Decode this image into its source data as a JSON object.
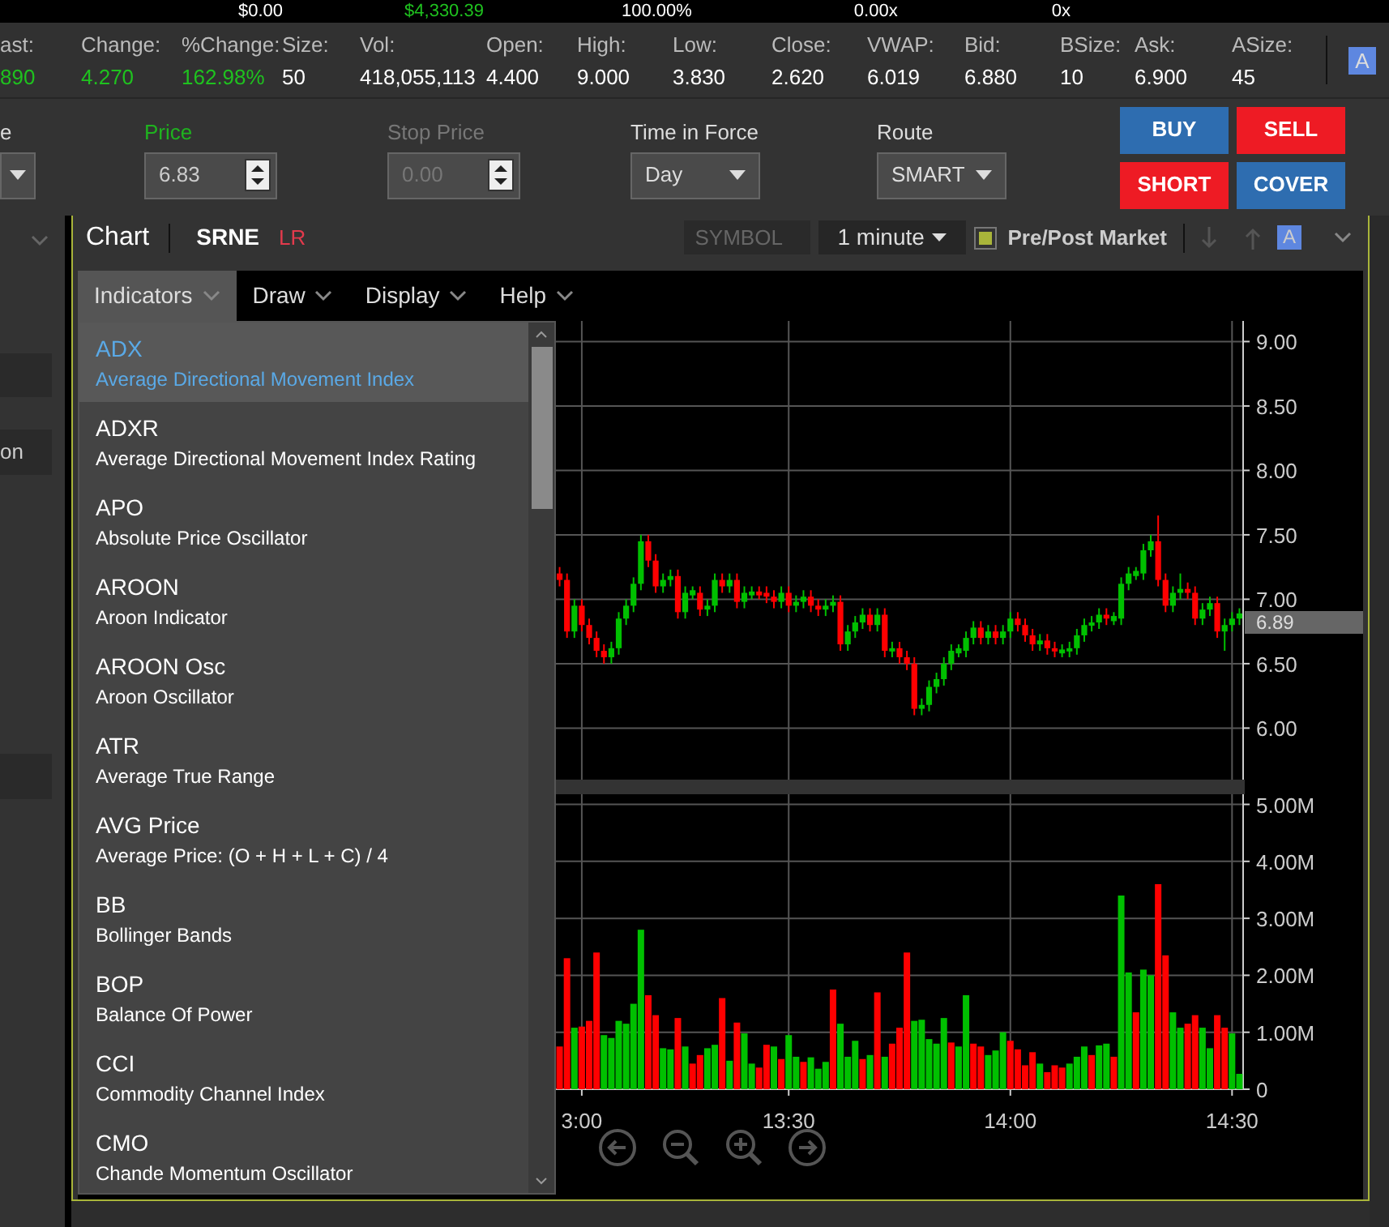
{
  "top_strip": [
    {
      "text": "$0.00",
      "color": "#ffffff"
    },
    {
      "text": "$4,330.39",
      "color": "#1fc21f"
    },
    {
      "text": "100.00%",
      "color": "#ffffff"
    },
    {
      "text": "0.00x",
      "color": "#ffffff"
    },
    {
      "text": "0x",
      "color": "#ffffff"
    }
  ],
  "quote": [
    {
      "label": "ast:",
      "value": "890",
      "color": "#1fc21f"
    },
    {
      "label": "Change:",
      "value": "4.270",
      "color": "#1fc21f"
    },
    {
      "label": "%Change:",
      "value": "162.98%",
      "color": "#1fc21f"
    },
    {
      "label": "Size:",
      "value": "50",
      "color": "#ffffff"
    },
    {
      "label": "Vol:",
      "value": "418,055,113",
      "color": "#ffffff"
    },
    {
      "label": "Open:",
      "value": "4.400",
      "color": "#ffffff"
    },
    {
      "label": "High:",
      "value": "9.000",
      "color": "#ffffff"
    },
    {
      "label": "Low:",
      "value": "3.830",
      "color": "#ffffff"
    },
    {
      "label": "Close:",
      "value": "2.620",
      "color": "#ffffff"
    },
    {
      "label": "VWAP:",
      "value": "6.019",
      "color": "#ffffff"
    },
    {
      "label": "Bid:",
      "value": "6.880",
      "color": "#ffffff"
    },
    {
      "label": "BSize:",
      "value": "10",
      "color": "#ffffff"
    },
    {
      "label": "Ask:",
      "value": "6.900",
      "color": "#ffffff"
    },
    {
      "label": "ASize:",
      "value": "45",
      "color": "#ffffff"
    }
  ],
  "quote_font_button": "A",
  "order_fields": [
    {
      "kind": "select",
      "label": "e",
      "active": false,
      "disabled": false
    },
    {
      "kind": "spinner",
      "label": "Price",
      "value": "6.83",
      "active": true,
      "disabled": false
    },
    {
      "kind": "spinner",
      "label": "Stop Price",
      "placeholder": "0.00",
      "active": false,
      "disabled": true
    },
    {
      "kind": "select",
      "label": "Time in Force",
      "value": "Day",
      "active": false,
      "disabled": false
    },
    {
      "kind": "select",
      "label": "Route",
      "value": "SMART",
      "active": false,
      "disabled": false
    }
  ],
  "order_buttons": [
    {
      "label": "BUY",
      "color": "#2e6db0"
    },
    {
      "label": "SELL",
      "color": "#ee1b24"
    },
    {
      "label": "SHORT",
      "color": "#ee1b24"
    },
    {
      "label": "COVER",
      "color": "#2e6db0"
    }
  ],
  "side_panel": {
    "items": [
      "on"
    ]
  },
  "chart_panel": {
    "title": "Chart",
    "symbol": "SRNE",
    "tag": "LR",
    "symbol_placeholder": "SYMBOL",
    "interval": "1 minute",
    "prepost": {
      "label": "Pre/Post Market",
      "checked": true
    },
    "font_button": "A"
  },
  "menu": [
    {
      "label": "Indicators",
      "selected": true
    },
    {
      "label": "Draw",
      "selected": false
    },
    {
      "label": "Display",
      "selected": false
    },
    {
      "label": "Help",
      "selected": false
    }
  ],
  "indicators": [
    {
      "code": "ADX",
      "name": "Average Directional Movement Index",
      "selected": true
    },
    {
      "code": "ADXR",
      "name": "Average Directional Movement Index Rating",
      "selected": false
    },
    {
      "code": "APO",
      "name": "Absolute Price Oscillator",
      "selected": false
    },
    {
      "code": "AROON",
      "name": "Aroon Indicator",
      "selected": false
    },
    {
      "code": "AROON Osc",
      "name": "Aroon Oscillator",
      "selected": false
    },
    {
      "code": "ATR",
      "name": "Average True Range",
      "selected": false
    },
    {
      "code": "AVG Price",
      "name": "Average Price: (O + H + L + C) / 4",
      "selected": false
    },
    {
      "code": "BB",
      "name": "Bollinger Bands",
      "selected": false
    },
    {
      "code": "BOP",
      "name": "Balance Of Power",
      "selected": false
    },
    {
      "code": "CCI",
      "name": "Commodity Channel Index",
      "selected": false
    },
    {
      "code": "CMO",
      "name": "Chande Momentum Oscillator",
      "selected": false
    }
  ],
  "price_chart": {
    "chart_data": {
      "type": "candlestick",
      "grid": true,
      "ylim": [
        5.6,
        9.16
      ],
      "yticks": [
        {
          "value": 6,
          "label": "6.00"
        },
        {
          "value": 6.5,
          "label": "6.50"
        },
        {
          "value": 7,
          "label": "7.00"
        },
        {
          "value": 7.5,
          "label": "7.50"
        },
        {
          "value": 8,
          "label": "8.00"
        },
        {
          "value": 8.5,
          "label": "8.50"
        },
        {
          "value": 9,
          "label": "9.00"
        }
      ],
      "categories": [
        null,
        null,
        null,
        null,
        null,
        null,
        null,
        null,
        null,
        null,
        null,
        null,
        null,
        null,
        null,
        null,
        null,
        null,
        null,
        null,
        null,
        null,
        null,
        null,
        null,
        null,
        null,
        null,
        null,
        null,
        null,
        null,
        null,
        null,
        null,
        null,
        null,
        null,
        null,
        null,
        null,
        null,
        null,
        null,
        null,
        null,
        null,
        null,
        null,
        null,
        null,
        null,
        null,
        null,
        null,
        null,
        null,
        null,
        null,
        null,
        null,
        null,
        null,
        null,
        null,
        null,
        null,
        null,
        null,
        null,
        null,
        null,
        null,
        null,
        null,
        null,
        null,
        null,
        null,
        null,
        null,
        null,
        null,
        null,
        null,
        null,
        null,
        null,
        null,
        null,
        null,
        null,
        null
      ],
      "ohlc": [
        [
          7.2,
          7.25,
          7.1,
          7.15
        ],
        [
          7.15,
          7.2,
          6.7,
          6.75
        ],
        [
          6.75,
          7,
          6.7,
          6.95
        ],
        [
          6.95,
          7,
          6.75,
          6.8
        ],
        [
          6.8,
          6.85,
          6.65,
          6.7
        ],
        [
          6.7,
          6.75,
          6.55,
          6.6
        ],
        [
          6.6,
          6.65,
          6.5,
          6.55
        ],
        [
          6.55,
          6.67,
          6.5,
          6.62
        ],
        [
          6.62,
          6.9,
          6.57,
          6.85
        ],
        [
          6.85,
          7,
          6.8,
          6.95
        ],
        [
          6.95,
          7.17,
          6.9,
          7.12
        ],
        [
          7.12,
          7.5,
          7.07,
          7.45
        ],
        [
          7.45,
          7.5,
          7.25,
          7.3
        ],
        [
          7.3,
          7.35,
          7.05,
          7.1
        ],
        [
          7.1,
          7.2,
          7.05,
          7.15
        ],
        [
          7.15,
          7.23,
          7.1,
          7.18
        ],
        [
          7.18,
          7.23,
          6.85,
          6.9
        ],
        [
          6.9,
          7.1,
          6.85,
          7.05
        ],
        [
          7.03,
          7.1,
          7,
          7.07
        ],
        [
          7.05,
          7.1,
          6.87,
          6.92
        ],
        [
          6.92,
          7,
          6.87,
          6.95
        ],
        [
          6.95,
          7.2,
          6.9,
          7.15
        ],
        [
          7.15,
          7.2,
          7.05,
          7.1
        ],
        [
          7.1,
          7.2,
          7.05,
          7.15
        ],
        [
          7.15,
          7.2,
          6.93,
          6.98
        ],
        [
          6.98,
          7.1,
          6.93,
          7.05
        ],
        [
          7.03,
          7.1,
          7,
          7.06
        ],
        [
          7.06,
          7.1,
          7,
          7.03
        ],
        [
          7.05,
          7.1,
          6.97,
          7.02
        ],
        [
          7.02,
          7.07,
          6.93,
          6.98
        ],
        [
          6.98,
          7.1,
          6.93,
          7.05
        ],
        [
          7.05,
          7.1,
          6.9,
          6.95
        ],
        [
          6.95,
          7.03,
          6.9,
          6.98
        ],
        [
          6.98,
          7.07,
          6.93,
          7.02
        ],
        [
          7.02,
          7.07,
          6.9,
          6.95
        ],
        [
          6.95,
          7,
          6.87,
          6.92
        ],
        [
          6.92,
          7,
          6.87,
          6.95
        ],
        [
          6.95,
          7.03,
          6.9,
          6.98
        ],
        [
          6.98,
          7.03,
          6.6,
          6.65
        ],
        [
          6.65,
          6.8,
          6.6,
          6.75
        ],
        [
          6.75,
          6.87,
          6.7,
          6.82
        ],
        [
          6.82,
          6.93,
          6.77,
          6.88
        ],
        [
          6.88,
          6.93,
          6.75,
          6.8
        ],
        [
          6.8,
          6.93,
          6.75,
          6.88
        ],
        [
          6.88,
          6.93,
          6.55,
          6.6
        ],
        [
          6.6,
          6.67,
          6.55,
          6.62
        ],
        [
          6.62,
          6.67,
          6.5,
          6.55
        ],
        [
          6.55,
          6.6,
          6.45,
          6.5
        ],
        [
          6.5,
          6.55,
          6.1,
          6.15
        ],
        [
          6.15,
          6.23,
          6.1,
          6.18
        ],
        [
          6.18,
          6.37,
          6.13,
          6.32
        ],
        [
          6.32,
          6.43,
          6.27,
          6.38
        ],
        [
          6.38,
          6.55,
          6.33,
          6.5
        ],
        [
          6.5,
          6.65,
          6.45,
          6.6
        ],
        [
          6.58,
          6.65,
          6.55,
          6.62
        ],
        [
          6.6,
          6.75,
          6.55,
          6.7
        ],
        [
          6.7,
          6.83,
          6.65,
          6.78
        ],
        [
          6.78,
          6.83,
          6.65,
          6.7
        ],
        [
          6.7,
          6.8,
          6.65,
          6.75
        ],
        [
          6.75,
          6.8,
          6.65,
          6.7
        ],
        [
          6.7,
          6.8,
          6.65,
          6.75
        ],
        [
          6.75,
          6.9,
          6.7,
          6.85
        ],
        [
          6.85,
          6.9,
          6.75,
          6.8
        ],
        [
          6.8,
          6.85,
          6.67,
          6.72
        ],
        [
          6.72,
          6.77,
          6.6,
          6.65
        ],
        [
          6.65,
          6.73,
          6.6,
          6.68
        ],
        [
          6.68,
          6.73,
          6.57,
          6.62
        ],
        [
          6.62,
          6.67,
          6.55,
          6.6
        ],
        [
          6.58,
          6.65,
          6.55,
          6.61
        ],
        [
          6.6,
          6.67,
          6.55,
          6.62
        ],
        [
          6.62,
          6.77,
          6.57,
          6.72
        ],
        [
          6.72,
          6.85,
          6.67,
          6.8
        ],
        [
          6.8,
          6.87,
          6.75,
          6.82
        ],
        [
          6.82,
          6.93,
          6.77,
          6.88
        ],
        [
          6.88,
          6.93,
          6.8,
          6.85
        ],
        [
          6.83,
          6.9,
          6.8,
          6.87
        ],
        [
          6.85,
          7.17,
          6.8,
          7.12
        ],
        [
          7.12,
          7.25,
          7.07,
          7.2
        ],
        [
          7.18,
          7.25,
          7.15,
          7.22
        ],
        [
          7.2,
          7.43,
          7.15,
          7.38
        ],
        [
          7.38,
          7.5,
          7.33,
          7.45
        ],
        [
          7.45,
          7.65,
          7.1,
          7.15
        ],
        [
          7.15,
          7.2,
          6.9,
          6.95
        ],
        [
          6.95,
          7.1,
          6.9,
          7.05
        ],
        [
          7.05,
          7.2,
          7,
          7.08
        ],
        [
          7.08,
          7.13,
          7,
          7.05
        ],
        [
          7.05,
          7.1,
          6.8,
          6.85
        ],
        [
          6.85,
          6.97,
          6.8,
          6.92
        ],
        [
          6.92,
          7.02,
          6.87,
          6.97
        ],
        [
          6.97,
          7.02,
          6.7,
          6.75
        ],
        [
          6.75,
          6.85,
          6.6,
          6.8
        ],
        [
          6.8,
          6.9,
          6.75,
          6.85
        ],
        [
          6.85,
          6.93,
          6.8,
          6.89
        ]
      ]
    },
    "last_price": "6.89"
  },
  "volume_chart": {
    "chart_data": {
      "type": "bar",
      "grid": true,
      "ylim": [
        0,
        5.15
      ],
      "yticks": [
        {
          "value": 0,
          "label": "0"
        },
        {
          "value": 1,
          "label": "1.00M"
        },
        {
          "value": 2,
          "label": "2.00M"
        },
        {
          "value": 3,
          "label": "3.00M"
        },
        {
          "value": 4,
          "label": "4.00M"
        },
        {
          "value": 5,
          "label": "5.00M"
        }
      ],
      "categories": [
        null,
        null,
        null,
        "3:00",
        null,
        null,
        null,
        null,
        null,
        null,
        null,
        null,
        null,
        null,
        null,
        null,
        null,
        null,
        null,
        null,
        null,
        null,
        null,
        null,
        null,
        null,
        null,
        null,
        null,
        null,
        null,
        "13:30",
        null,
        null,
        null,
        null,
        null,
        null,
        null,
        null,
        null,
        null,
        null,
        null,
        null,
        null,
        null,
        null,
        null,
        null,
        null,
        null,
        null,
        null,
        null,
        null,
        null,
        null,
        null,
        null,
        null,
        "14:00",
        null,
        null,
        null,
        null,
        null,
        null,
        null,
        null,
        null,
        null,
        null,
        null,
        null,
        null,
        null,
        null,
        null,
        null,
        null,
        null,
        null,
        null,
        null,
        null,
        null,
        null,
        null,
        null,
        null,
        "14:30",
        null
      ],
      "series": [
        {
          "color": "#00c000",
          "values": [
            null,
            null,
            1.08,
            null,
            null,
            null,
            0.95,
            0.9,
            1.2,
            1.15,
            1.5,
            2.8,
            null,
            null,
            0.72,
            0.7,
            null,
            0.75,
            null,
            null,
            0.72,
            0.78,
            null,
            0.5,
            null,
            0.98,
            0.45,
            null,
            null,
            0.75,
            null,
            0.95,
            0.57,
            null,
            0.56,
            0.36,
            0.48,
            null,
            1.15,
            0.57,
            0.85,
            null,
            0.6,
            null,
            0.57,
            null,
            null,
            null,
            1.2,
            1.22,
            0.88,
            0.8,
            1.25,
            null,
            0.75,
            1.65,
            null,
            null,
            0.6,
            0.68,
            1.0,
            null,
            null,
            null,
            null,
            0.45,
            null,
            null,
            null,
            0.45,
            0.57,
            0.75,
            null,
            0.77,
            0.8,
            null,
            3.4,
            2.05,
            null,
            2.1,
            2.0,
            null,
            null,
            1.35,
            1.08,
            null,
            null,
            1.08,
            0.72,
            null,
            null,
            0.98,
            0.27
          ]
        },
        {
          "color": "#ff0000",
          "values": [
            0.75,
            2.3,
            null,
            1.1,
            1.2,
            2.4,
            null,
            null,
            null,
            null,
            null,
            null,
            1.65,
            1.3,
            null,
            null,
            1.25,
            null,
            0.45,
            0.6,
            null,
            null,
            1.6,
            null,
            1.17,
            null,
            null,
            0.38,
            0.78,
            null,
            0.53,
            null,
            null,
            0.48,
            null,
            null,
            null,
            1.75,
            null,
            null,
            null,
            0.53,
            null,
            1.7,
            null,
            0.8,
            1.08,
            2.4,
            null,
            null,
            null,
            null,
            null,
            0.82,
            null,
            null,
            0.8,
            0.75,
            null,
            null,
            null,
            0.85,
            0.7,
            0.42,
            0.65,
            null,
            0.3,
            0.42,
            0.38,
            null,
            null,
            null,
            0.6,
            null,
            null,
            0.57,
            null,
            null,
            1.35,
            null,
            null,
            3.6,
            2.35,
            null,
            null,
            1.15,
            1.3,
            null,
            null,
            1.3,
            1.08,
            null,
            null
          ]
        }
      ]
    }
  }
}
